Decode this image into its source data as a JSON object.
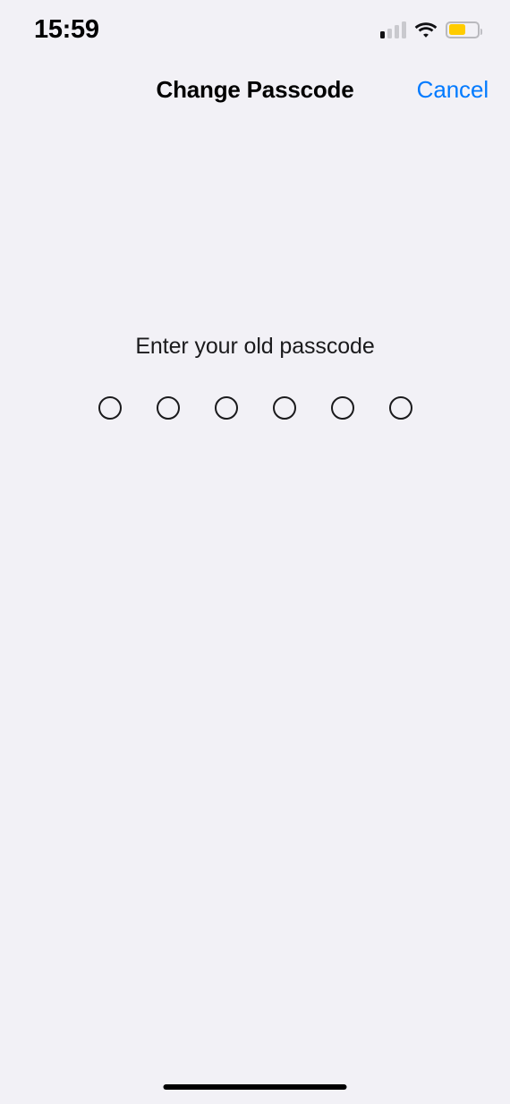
{
  "status_bar": {
    "time": "15:59",
    "cellular_icon": "cellular-signal-icon",
    "cellular_bars_total": 4,
    "cellular_bars_active": 1,
    "wifi_icon": "wifi-icon",
    "wifi_strength": "full",
    "battery_icon": "battery-icon",
    "battery_level_percent": 60,
    "battery_color": "#FFCC00"
  },
  "nav_bar": {
    "title": "Change Passcode",
    "cancel_label": "Cancel",
    "accent_color": "#007AFF"
  },
  "passcode": {
    "prompt": "Enter your old passcode",
    "dot_count": 6,
    "filled_count": 0,
    "dots": [
      {
        "filled": false
      },
      {
        "filled": false
      },
      {
        "filled": false
      },
      {
        "filled": false
      },
      {
        "filled": false
      },
      {
        "filled": false
      }
    ]
  },
  "home_indicator": {
    "label": "home-indicator"
  },
  "theme": {
    "background": "#F2F1F6",
    "text_primary": "#000000",
    "text_secondary": "#1A1A1C"
  }
}
